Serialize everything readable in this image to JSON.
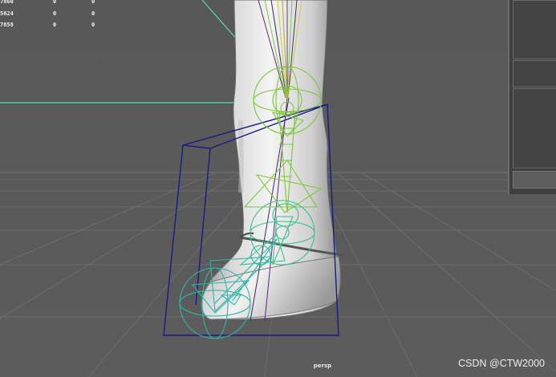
{
  "hud": {
    "rows": [
      [
        "7860",
        "0",
        "0"
      ],
      [
        "5624",
        "0",
        "0"
      ],
      [
        "7858",
        "0",
        "0"
      ]
    ]
  },
  "viewport": {
    "camera": "persp",
    "colors": {
      "background": "#5a5a5a",
      "grid": "#6c6c6c",
      "bounding_box": "#1a1a88",
      "rig_green": "#7dc83a",
      "rig_teal": "#2bb6a6",
      "guide_line": "#55e0a8"
    }
  },
  "watermark": "CSDN @CTW2000"
}
